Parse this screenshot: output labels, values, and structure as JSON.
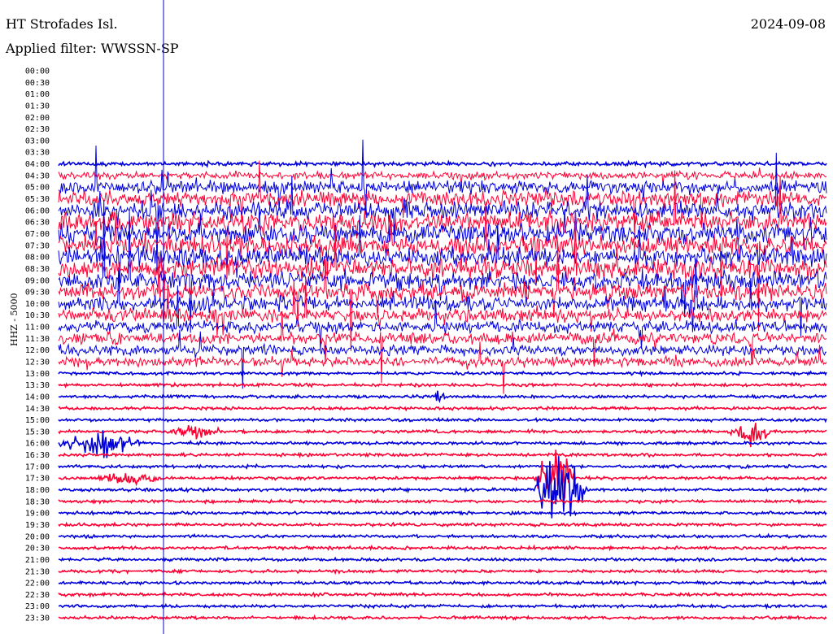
{
  "header": {
    "station": "HT Strofades Isl.",
    "date": "2024-09-08",
    "filter_prefix": "Applied filter: ",
    "filter": "WWSSN-SP"
  },
  "chart_data": {
    "type": "line",
    "channel": "HHZ - 5000",
    "ylabels": [
      "00:00",
      "00:30",
      "01:00",
      "01:30",
      "02:00",
      "02:30",
      "03:00",
      "03:30",
      "04:00",
      "04:30",
      "05:00",
      "05:30",
      "06:00",
      "06:30",
      "07:00",
      "07:30",
      "08:00",
      "08:30",
      "09:00",
      "09:30",
      "10:00",
      "10:30",
      "11:00",
      "11:30",
      "12:00",
      "12:30",
      "13:00",
      "13:30",
      "14:00",
      "14:30",
      "15:00",
      "15:30",
      "16:00",
      "16:30",
      "17:00",
      "17:30",
      "18:00",
      "18:30",
      "19:00",
      "19:30",
      "20:00",
      "20:30",
      "21:00",
      "21:30",
      "22:00",
      "22:30",
      "23:00",
      "23:30"
    ],
    "first_trace_row": "04:00",
    "trace_colors": [
      "#0000dd",
      "#ff0033"
    ],
    "marker_color": "#0000cc",
    "noise_levels": [
      0,
      0,
      0,
      0,
      0,
      0,
      0,
      0,
      0.2,
      0.5,
      1,
      1.3,
      1.5,
      1.6,
      1.6,
      1.6,
      1.6,
      1.6,
      1.5,
      1.4,
      1.2,
      1,
      0.9,
      0.9,
      0.8,
      0.7,
      0.1,
      0.1,
      0.1,
      0.1,
      0.1,
      0.1,
      0.1,
      0.1,
      0.1,
      0.1,
      0.1,
      0.1,
      0.1,
      0.1,
      0.1,
      0.1,
      0.1,
      0.1,
      0.1,
      0.1,
      0.1,
      0.1
    ],
    "events": [
      {
        "row": "16:00",
        "start": 0.0,
        "end": 0.16,
        "level": 0.8
      },
      {
        "row": "15:30",
        "start": 0.87,
        "end": 0.96,
        "level": 0.8
      },
      {
        "row": "17:30",
        "start": 0.62,
        "end": 0.7,
        "level": 2.2
      },
      {
        "row": "18:00",
        "start": 0.62,
        "end": 0.72,
        "level": 2.6
      },
      {
        "row": "17:30",
        "start": 0.05,
        "end": 0.18,
        "level": 0.45
      },
      {
        "row": "14:00",
        "start": 0.49,
        "end": 0.51,
        "level": 0.6
      },
      {
        "row": "15:30",
        "start": 0.15,
        "end": 0.25,
        "level": 0.35
      }
    ]
  }
}
